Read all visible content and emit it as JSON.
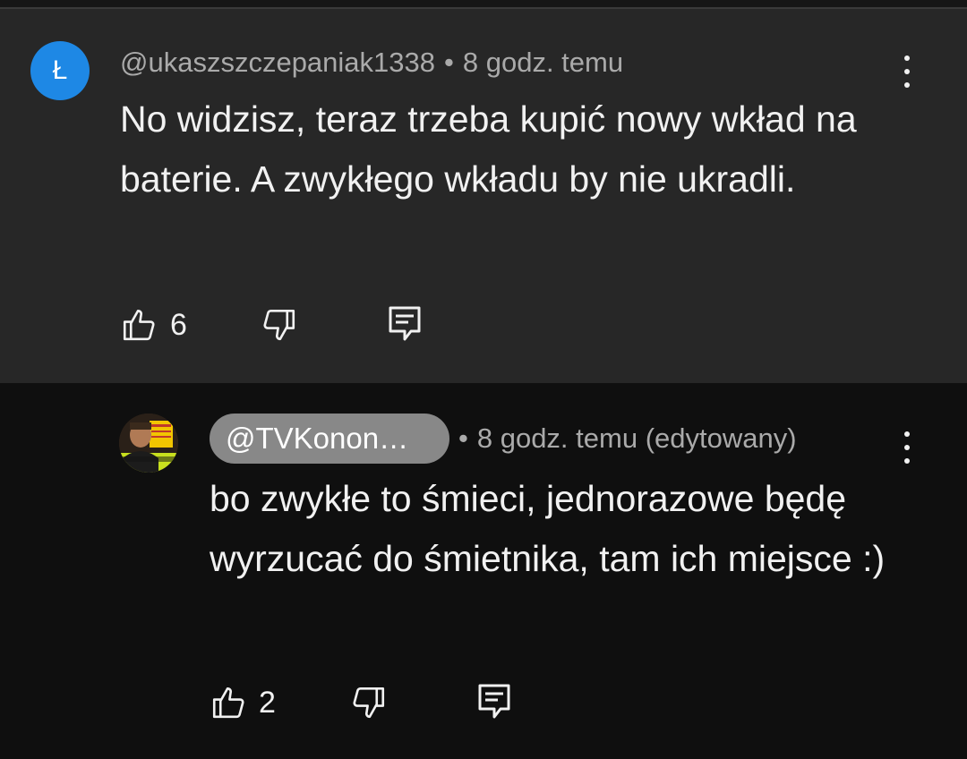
{
  "comment": {
    "avatar_letter": "Ł",
    "author": "@ukaszszczepaniak1338",
    "separator": "•",
    "time": "8 godz. temu",
    "text": "No widzisz, teraz trzeba kupić nowy wkład na baterie. A zwykłego wkładu by nie ukradli.",
    "like_count": "6"
  },
  "reply": {
    "author": "@TVKonon…",
    "separator": "•",
    "time": "8 godz. temu (edytowany)",
    "text": "bo zwykłe to śmieci, jednorazowe będę wyrzucać do śmietnika, tam ich miejsce :)",
    "like_count": "2"
  },
  "icons": {
    "like": "thumb-up-icon",
    "dislike": "thumb-down-icon",
    "reply": "comment-reply-icon",
    "more": "more-vertical-icon"
  },
  "colors": {
    "comment_bg": "#272727",
    "reply_bg": "#0f0f0f",
    "avatar_blue": "#1e88e5",
    "meta_gray": "#aaaaaa",
    "pill_gray": "#888888"
  }
}
